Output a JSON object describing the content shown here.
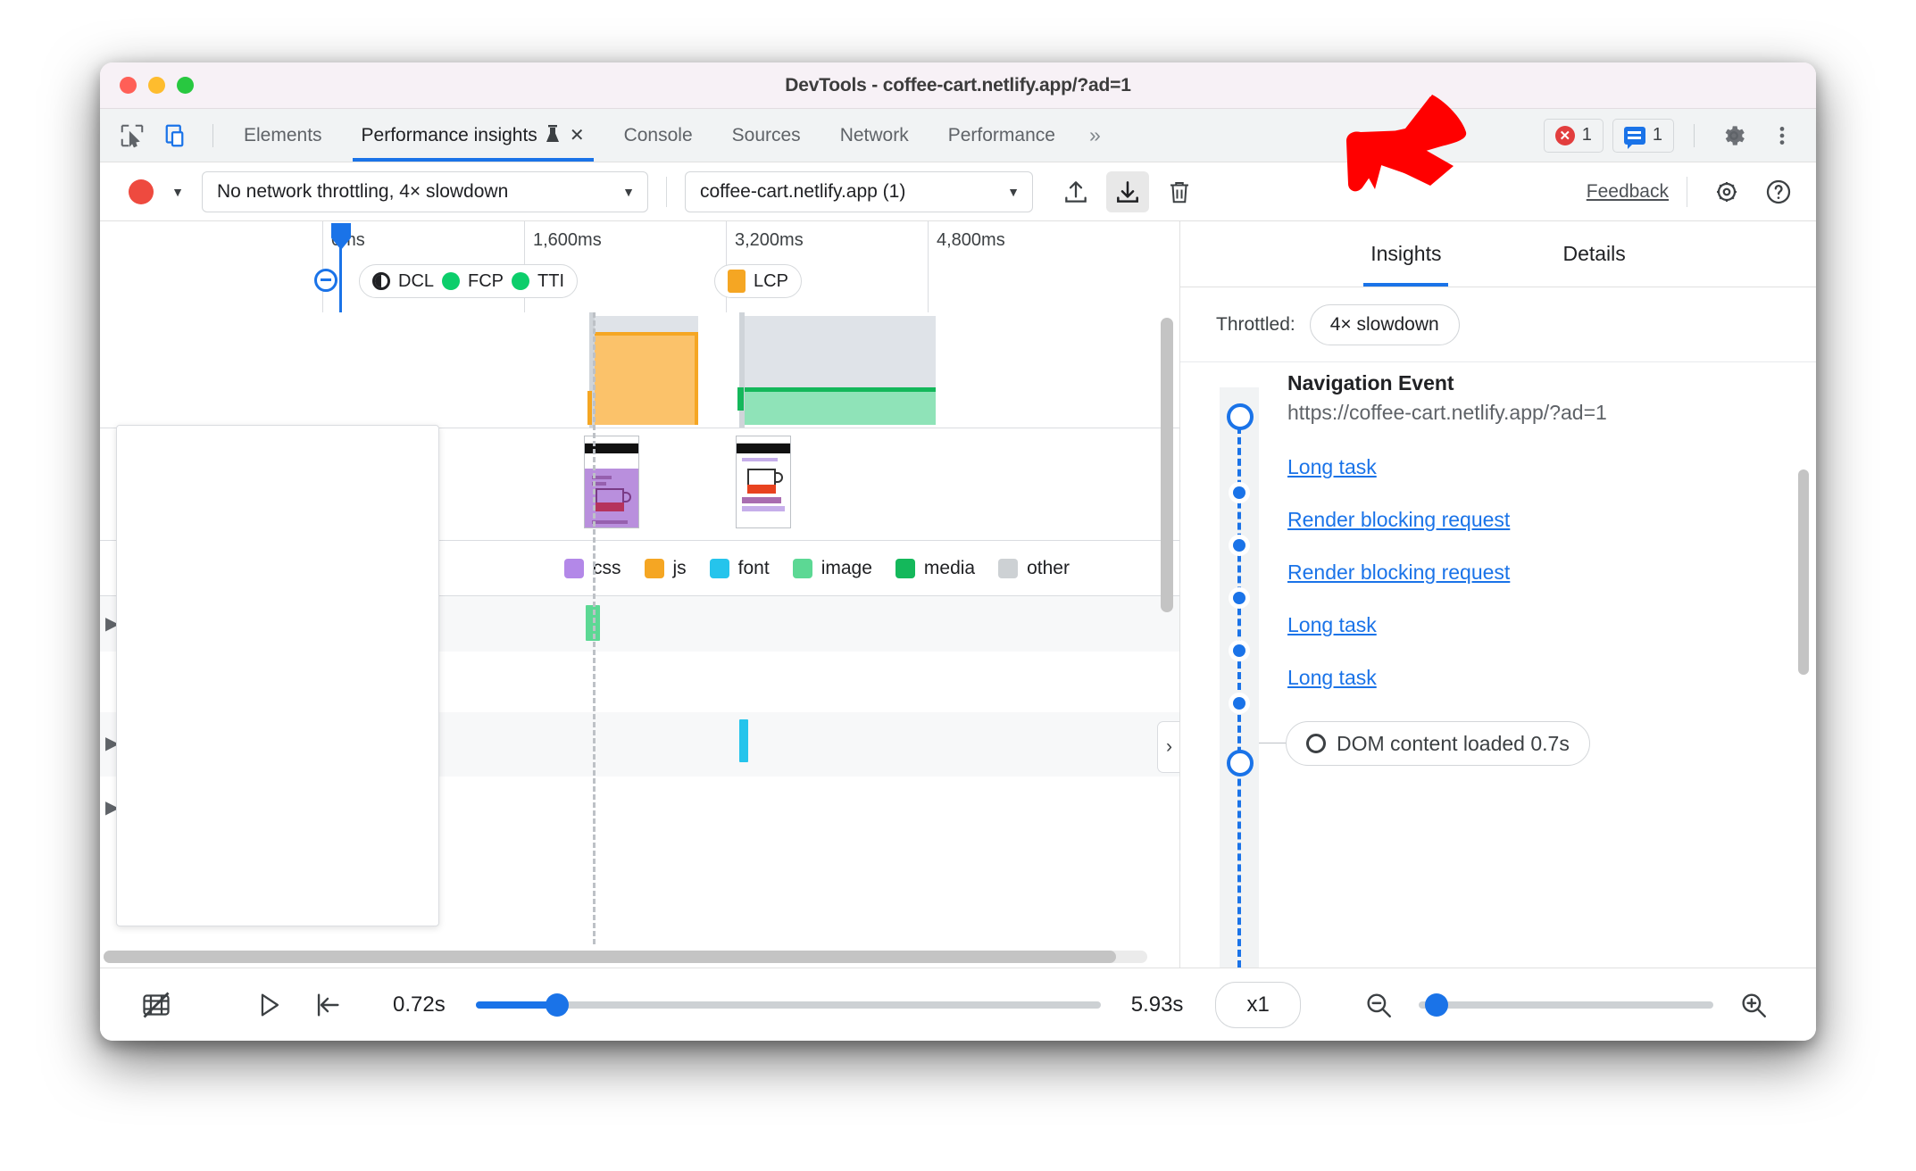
{
  "window": {
    "title": "DevTools - coffee-cart.netlify.app/?ad=1"
  },
  "tabstrip": {
    "inspect_icon": "inspect-cursor-icon",
    "device_icon": "device-toolbar-icon",
    "tabs": [
      {
        "label": "Elements",
        "active": false
      },
      {
        "label": "Performance insights",
        "active": true,
        "experimental": true,
        "closable": true
      },
      {
        "label": "Console",
        "active": false
      },
      {
        "label": "Sources",
        "active": false
      },
      {
        "label": "Network",
        "active": false
      },
      {
        "label": "Performance",
        "active": false
      }
    ],
    "more_tabs": "»",
    "error_count": "1",
    "message_count": "1",
    "settings_icon": "gear-icon",
    "more_icon": "kebab-menu-icon"
  },
  "toolbar": {
    "record_label": "record-button",
    "throttling_value": "No network throttling, 4× slowdown",
    "page_value": "coffee-cart.netlify.app (1)",
    "upload_label": "upload-icon",
    "download_label": "download-icon",
    "trash_label": "trash-icon",
    "feedback_label": "Feedback",
    "settings_label": "settings-gear-icon",
    "help_label": "help-icon"
  },
  "timeline": {
    "ruler_ticks": [
      "0ms",
      "1,600ms",
      "3,200ms",
      "4,800ms"
    ],
    "markers": [
      {
        "label": "DCL",
        "color": "#202124",
        "style": "half"
      },
      {
        "label": "FCP",
        "color": "#0cce6b",
        "style": "dot"
      },
      {
        "label": "TTI",
        "color": "#0cce6b",
        "style": "dot"
      },
      {
        "label": "LCP",
        "color": "#f5a623",
        "style": "square"
      }
    ],
    "legend": [
      {
        "label": "css",
        "color": "#b388e8"
      },
      {
        "label": "js",
        "color": "#f5a623"
      },
      {
        "label": "font",
        "color": "#25c4ec"
      },
      {
        "label": "image",
        "color": "#5cd894"
      },
      {
        "label": "media",
        "color": "#14b85b"
      },
      {
        "label": "other",
        "color": "#cdd1d4"
      }
    ],
    "collapse_handle": "›"
  },
  "sidebar": {
    "tabs": [
      {
        "label": "Insights",
        "active": true
      },
      {
        "label": "Details",
        "active": false
      }
    ],
    "throttled_label": "Throttled:",
    "throttled_value": "4× slowdown",
    "navigation_title": "Navigation Event",
    "navigation_url": "https://coffee-cart.netlify.app/?ad=1",
    "items": [
      {
        "label": "Long task"
      },
      {
        "label": "Render blocking request"
      },
      {
        "label": "Render blocking request"
      },
      {
        "label": "Long task"
      },
      {
        "label": "Long task"
      }
    ],
    "dcl_chip": "DOM content loaded 0.7s"
  },
  "bottombar": {
    "filmstrip_icon": "filmstrip-off-icon",
    "play_icon": "play-icon",
    "reset_icon": "jump-to-start-icon",
    "start_time": "0.72s",
    "end_time": "5.93s",
    "speed": "x1",
    "zoom_out_icon": "zoom-out-icon",
    "zoom_in_icon": "zoom-in-icon"
  },
  "annotation": {
    "arrow_color": "#ff0000",
    "arrow_target": "download-icon"
  }
}
